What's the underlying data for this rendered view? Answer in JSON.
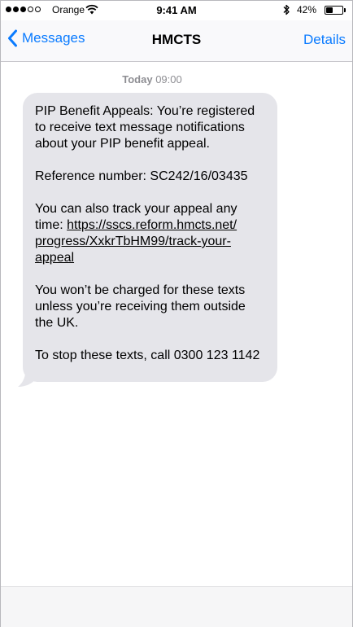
{
  "status_bar": {
    "carrier": "Orange",
    "time": "9:41 AM",
    "battery_percent": "42%",
    "battery_level": 0.42,
    "signal_bars_filled": 3,
    "signal_bars_total": 5
  },
  "nav": {
    "back_label": "Messages",
    "title": "HMCTS",
    "details_label": "Details"
  },
  "conversation": {
    "timestamp_day": "Today",
    "timestamp_time": "09:00",
    "message": {
      "p1_l1": "PIP Benefit Appeals: You’re registered",
      "p1_l2": "to receive text message notifications",
      "p1_l3": "about your PIP benefit appeal.",
      "p2_l1": "Reference number: SC242/16/03435",
      "p3_l1": "You can also track your appeal any",
      "p3_l2_prefix": "time: ",
      "link_l1": "https://sscs.reform.hmcts.net/",
      "link_l2": "progress/XxkrTbHM99/track-your-",
      "link_l3": "appeal",
      "p4_l1": "You won’t be charged for these texts",
      "p4_l2": "unless you’re receiving them outside",
      "p4_l3": "the UK.",
      "p5_l1": "To stop these texts, call 0300 123 1142"
    }
  },
  "colors": {
    "accent": "#0a7bff",
    "bubble": "#e5e5ea",
    "timestamp": "#8e8e93"
  },
  "icons": {
    "back": "chevron-left-icon",
    "wifi": "wifi-icon",
    "bluetooth": "bluetooth-icon",
    "battery": "battery-icon"
  }
}
